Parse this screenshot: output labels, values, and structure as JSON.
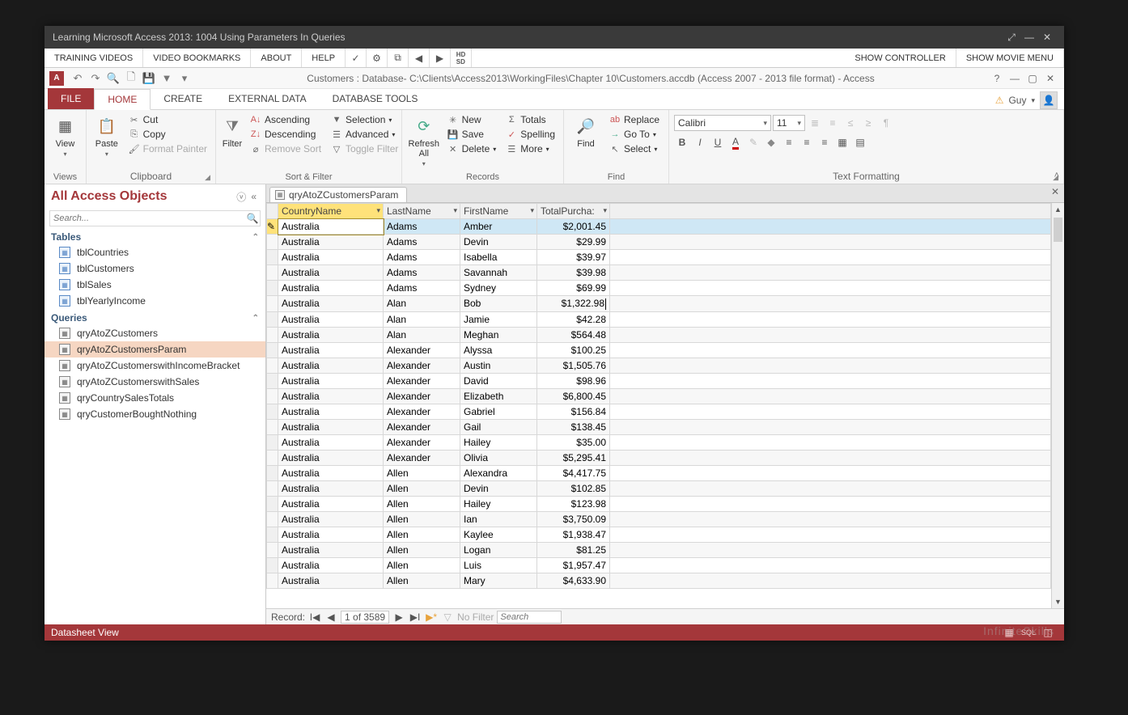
{
  "window": {
    "lesson_title": "Learning Microsoft Access 2013: 1004 Using Parameters In Queries",
    "db_title": "Customers : Database- C:\\Clients\\Access2013\\WorkingFiles\\Chapter 10\\Customers.accdb (Access 2007 - 2013 file format) - Access"
  },
  "video_menu": {
    "items": [
      "TRAINING VIDEOS",
      "VIDEO BOOKMARKS",
      "ABOUT",
      "HELP"
    ],
    "right": [
      "SHOW CONTROLLER",
      "SHOW MOVIE MENU"
    ]
  },
  "ribbon_tabs": {
    "file": "FILE",
    "home": "HOME",
    "create": "CREATE",
    "external": "EXTERNAL DATA",
    "dbtools": "DATABASE TOOLS"
  },
  "user": {
    "name": "Guy"
  },
  "ribbon": {
    "views": {
      "view": "View",
      "group": "Views"
    },
    "clipboard": {
      "paste": "Paste",
      "cut": "Cut",
      "copy": "Copy",
      "painter": "Format Painter",
      "group": "Clipboard"
    },
    "sortfilter": {
      "filter": "Filter",
      "asc": "Ascending",
      "desc": "Descending",
      "remove": "Remove Sort",
      "selection": "Selection",
      "advanced": "Advanced",
      "toggle": "Toggle Filter",
      "group": "Sort & Filter"
    },
    "records": {
      "refresh": "Refresh All",
      "new": "New",
      "save": "Save",
      "delete": "Delete",
      "totals": "Totals",
      "spelling": "Spelling",
      "more": "More",
      "group": "Records"
    },
    "find": {
      "find": "Find",
      "replace": "Replace",
      "goto": "Go To",
      "select": "Select",
      "group": "Find"
    },
    "format": {
      "font": "Calibri",
      "size": "11",
      "group": "Text Formatting"
    }
  },
  "nav": {
    "title": "All Access Objects",
    "search_ph": "Search...",
    "tables_hdr": "Tables",
    "queries_hdr": "Queries",
    "tables": [
      "tblCountries",
      "tblCustomers",
      "tblSales",
      "tblYearlyIncome"
    ],
    "queries": [
      "qryAtoZCustomers",
      "qryAtoZCustomersParam",
      "qryAtoZCustomerswithIncomeBracket",
      "qryAtoZCustomerswithSales",
      "qryCountrySalesTotals",
      "qryCustomerBoughtNothing"
    ]
  },
  "doc": {
    "tab": "qryAtoZCustomersParam"
  },
  "grid": {
    "cols": [
      "CountryName",
      "LastName",
      "FirstName",
      "TotalPurcha:"
    ],
    "rows": [
      [
        "Australia",
        "Adams",
        "Amber",
        "$2,001.45"
      ],
      [
        "Australia",
        "Adams",
        "Devin",
        "$29.99"
      ],
      [
        "Australia",
        "Adams",
        "Isabella",
        "$39.97"
      ],
      [
        "Australia",
        "Adams",
        "Savannah",
        "$39.98"
      ],
      [
        "Australia",
        "Adams",
        "Sydney",
        "$69.99"
      ],
      [
        "Australia",
        "Alan",
        "Bob",
        "$1,322.98"
      ],
      [
        "Australia",
        "Alan",
        "Jamie",
        "$42.28"
      ],
      [
        "Australia",
        "Alan",
        "Meghan",
        "$564.48"
      ],
      [
        "Australia",
        "Alexander",
        "Alyssa",
        "$100.25"
      ],
      [
        "Australia",
        "Alexander",
        "Austin",
        "$1,505.76"
      ],
      [
        "Australia",
        "Alexander",
        "David",
        "$98.96"
      ],
      [
        "Australia",
        "Alexander",
        "Elizabeth",
        "$6,800.45"
      ],
      [
        "Australia",
        "Alexander",
        "Gabriel",
        "$156.84"
      ],
      [
        "Australia",
        "Alexander",
        "Gail",
        "$138.45"
      ],
      [
        "Australia",
        "Alexander",
        "Hailey",
        "$35.00"
      ],
      [
        "Australia",
        "Alexander",
        "Olivia",
        "$5,295.41"
      ],
      [
        "Australia",
        "Allen",
        "Alexandra",
        "$4,417.75"
      ],
      [
        "Australia",
        "Allen",
        "Devin",
        "$102.85"
      ],
      [
        "Australia",
        "Allen",
        "Hailey",
        "$123.98"
      ],
      [
        "Australia",
        "Allen",
        "Ian",
        "$3,750.09"
      ],
      [
        "Australia",
        "Allen",
        "Kaylee",
        "$1,938.47"
      ],
      [
        "Australia",
        "Allen",
        "Logan",
        "$81.25"
      ],
      [
        "Australia",
        "Allen",
        "Luis",
        "$1,957.47"
      ],
      [
        "Australia",
        "Allen",
        "Mary",
        "$4,633.90"
      ]
    ]
  },
  "recnav": {
    "label": "Record:",
    "pos": "1 of 3589",
    "nofilter": "No Filter",
    "search_ph": "Search"
  },
  "status": {
    "view": "Datasheet View"
  },
  "brand": "InfiniteSkills"
}
